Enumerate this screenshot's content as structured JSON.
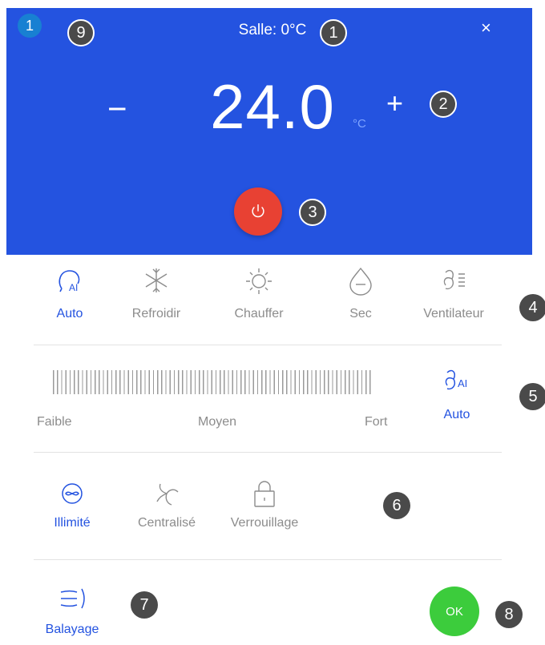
{
  "header": {
    "title": "Salle: 0°C",
    "close": "×",
    "minus": "−",
    "temperature": "24.0",
    "unit": "°C",
    "plus": "+"
  },
  "modes": [
    {
      "label": "Auto",
      "icon": "auto-ai-icon",
      "active": true
    },
    {
      "label": "Refroidir",
      "icon": "snowflake-icon",
      "active": false
    },
    {
      "label": "Chauffer",
      "icon": "sun-icon",
      "active": false
    },
    {
      "label": "Sec",
      "icon": "droplet-icon",
      "active": false
    },
    {
      "label": "Ventilateur",
      "icon": "fan-icon",
      "active": false
    }
  ],
  "fan_speed": {
    "labels": [
      "Faible",
      "Moyen",
      "Fort"
    ],
    "auto_label": "Auto",
    "auto_icon": "fan-ai-icon"
  },
  "functions": [
    {
      "label": "Illimité",
      "icon": "unlimited-icon",
      "active": true
    },
    {
      "label": "Centralisé",
      "icon": "centralized-icon",
      "active": false
    },
    {
      "label": "Verrouillage",
      "icon": "lock-icon",
      "active": false
    }
  ],
  "swing": {
    "label": "Balayage",
    "icon": "swing-icon"
  },
  "ok_label": "OK",
  "annotations": {
    "corner": "1",
    "n9": "9",
    "n1": "1",
    "n2": "2",
    "n3": "3",
    "n4": "4",
    "n5": "5",
    "n6": "6",
    "n7": "7",
    "n8": "8"
  },
  "colors": {
    "header_bg": "#2453e0",
    "accent": "#2453e0",
    "power": "#e84133",
    "ok": "#3ccc3c",
    "badge": "#4a4a4a"
  }
}
